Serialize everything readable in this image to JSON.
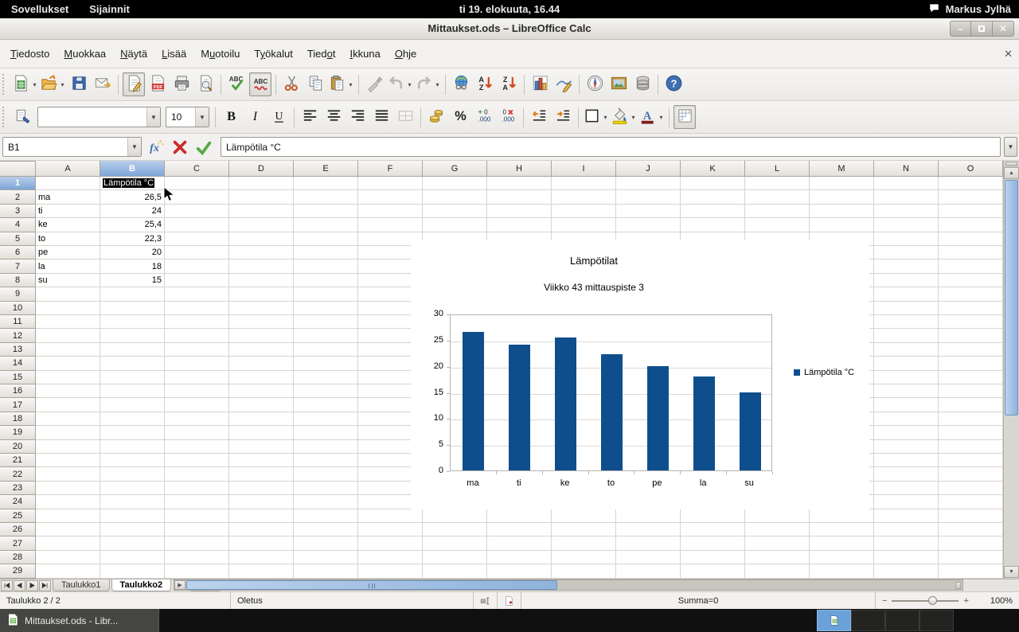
{
  "desktop": {
    "topbar": {
      "menus": [
        {
          "label": "Sovellukset"
        },
        {
          "label": "Sijainnit"
        }
      ],
      "clock": "ti 19. elokuuta, 16.44",
      "user": "Markus Jylhä"
    },
    "taskbar": {
      "active_window": "Mittaukset.ods - Libr...",
      "workspace_count": 4,
      "active_workspace": 1
    }
  },
  "window": {
    "title": "Mittaukset.ods – LibreOffice Calc"
  },
  "menubar": {
    "items": [
      {
        "label": "Tiedosto",
        "u": 0
      },
      {
        "label": "Muokkaa",
        "u": 0
      },
      {
        "label": "Näytä",
        "u": 0
      },
      {
        "label": "Lisää",
        "u": 0
      },
      {
        "label": "Muotoilu",
        "u": 1
      },
      {
        "label": "Työkalut",
        "u": 1
      },
      {
        "label": "Tiedot",
        "u": 4
      },
      {
        "label": "Ikkuna",
        "u": 0
      },
      {
        "label": "Ohje",
        "u": 0
      }
    ],
    "close_doc": "✕"
  },
  "toolbars": {
    "standard": [
      {
        "name": "new-document-button",
        "icon": "new",
        "dropdown": true
      },
      {
        "name": "open-button",
        "icon": "open",
        "dropdown": true
      },
      {
        "name": "save-button",
        "icon": "save"
      },
      {
        "name": "email-button",
        "icon": "email"
      },
      {
        "type": "sep"
      },
      {
        "name": "edit-mode-button",
        "icon": "edit",
        "framed": true
      },
      {
        "name": "export-pdf-button",
        "icon": "pdf"
      },
      {
        "name": "print-button",
        "icon": "print"
      },
      {
        "name": "print-preview-button",
        "icon": "preview"
      },
      {
        "type": "sep"
      },
      {
        "name": "spellcheck-button",
        "icon": "spell"
      },
      {
        "name": "auto-spellcheck-button",
        "icon": "autospell",
        "framed": true
      },
      {
        "type": "sep"
      },
      {
        "name": "cut-button",
        "icon": "cut"
      },
      {
        "name": "copy-button",
        "icon": "copy"
      },
      {
        "name": "paste-button",
        "icon": "paste",
        "dropdown": true
      },
      {
        "type": "sep"
      },
      {
        "name": "clone-formatting-button",
        "icon": "brush",
        "disabled": true
      },
      {
        "name": "undo-button",
        "icon": "undo",
        "disabled": true,
        "dropdown": true
      },
      {
        "name": "redo-button",
        "icon": "redo",
        "disabled": true,
        "dropdown": true
      },
      {
        "type": "sep"
      },
      {
        "name": "hyperlink-button",
        "icon": "globe"
      },
      {
        "name": "sort-ascending-button",
        "icon": "sortaz"
      },
      {
        "name": "sort-descending-button",
        "icon": "sortza"
      },
      {
        "type": "sep"
      },
      {
        "name": "insert-chart-button",
        "icon": "chart"
      },
      {
        "name": "draw-functions-button",
        "icon": "draw"
      },
      {
        "type": "sep"
      },
      {
        "name": "navigator-button",
        "icon": "navigator"
      },
      {
        "name": "gallery-button",
        "icon": "gallery"
      },
      {
        "name": "data-sources-button",
        "icon": "datasource"
      },
      {
        "type": "sep"
      },
      {
        "name": "help-button",
        "icon": "help"
      }
    ],
    "formatting": [
      {
        "name": "apply-style-button",
        "icon": "stylepaint"
      },
      {
        "type": "combo",
        "name": "font-name-combo",
        "value": "",
        "width": 155
      },
      {
        "type": "combo",
        "name": "font-size-combo",
        "value": "10",
        "width": 55
      },
      {
        "type": "sep"
      },
      {
        "name": "bold-button",
        "icon": "bold"
      },
      {
        "name": "italic-button",
        "icon": "italic"
      },
      {
        "name": "underline-button",
        "icon": "underline"
      },
      {
        "type": "sep"
      },
      {
        "name": "align-left-button",
        "icon": "alignl"
      },
      {
        "name": "align-center-button",
        "icon": "alignc"
      },
      {
        "name": "align-right-button",
        "icon": "alignr"
      },
      {
        "name": "align-justify-button",
        "icon": "alignj"
      },
      {
        "name": "merge-cells-button",
        "icon": "merge",
        "disabled": true
      },
      {
        "type": "sep"
      },
      {
        "name": "currency-format-button",
        "icon": "currency"
      },
      {
        "name": "percent-format-button",
        "icon": "percent"
      },
      {
        "name": "add-decimal-button",
        "icon": "adddec"
      },
      {
        "name": "delete-decimal-button",
        "icon": "deldec"
      },
      {
        "type": "sep"
      },
      {
        "name": "decrease-indent-button",
        "icon": "outdent"
      },
      {
        "name": "increase-indent-button",
        "icon": "indent"
      },
      {
        "type": "sep"
      },
      {
        "name": "borders-button",
        "icon": "borders",
        "dropdown": true
      },
      {
        "name": "background-color-button",
        "icon": "bgcolor",
        "dropdown": true
      },
      {
        "name": "font-color-button",
        "icon": "fontcolor",
        "dropdown": true
      },
      {
        "type": "sep"
      },
      {
        "name": "freeze-panes-button",
        "icon": "gridtoggle",
        "framed": true
      }
    ]
  },
  "formula_bar": {
    "cell_ref": "B1",
    "input": "Lämpötila °C"
  },
  "sheet": {
    "columns": [
      "A",
      "B",
      "C",
      "D",
      "E",
      "F",
      "G",
      "H",
      "I",
      "J",
      "K",
      "L",
      "M",
      "N",
      "O"
    ],
    "visible_rows": 29,
    "selected_column": "B",
    "selected_row": 1,
    "edit_cell": {
      "ref": "B1",
      "value": "Lämpötila °C"
    },
    "cells": {
      "A2": "ma",
      "B2": "26,5",
      "A3": "ti",
      "B3": "24",
      "A4": "ke",
      "B4": "25,4",
      "A5": "to",
      "B5": "22,3",
      "A6": "pe",
      "B6": "20",
      "A7": "la",
      "B7": "18",
      "A8": "su",
      "B8": "15"
    }
  },
  "chart_data": {
    "type": "bar",
    "title": "Lämpötilat",
    "subtitle": "Viikko 43 mittauspiste 3",
    "categories": [
      "ma",
      "ti",
      "ke",
      "to",
      "pe",
      "la",
      "su"
    ],
    "series": [
      {
        "name": "Lämpötila °C",
        "values": [
          26.5,
          24,
          25.4,
          22.3,
          20,
          18,
          15
        ]
      }
    ],
    "ylim": [
      0,
      30
    ],
    "ytick_step": 5,
    "grid": true,
    "legend_position": "right",
    "bar_color": "#0f4e8d"
  },
  "sheet_tabs": {
    "tabs": [
      {
        "label": "Taulukko1",
        "active": false
      },
      {
        "label": "Taulukko2",
        "active": true
      }
    ],
    "add_label": "+"
  },
  "status_bar": {
    "sheet_info": "Taulukko 2 / 2",
    "page_style": "Oletus",
    "sum": "Summa=0",
    "zoom": "100%"
  }
}
